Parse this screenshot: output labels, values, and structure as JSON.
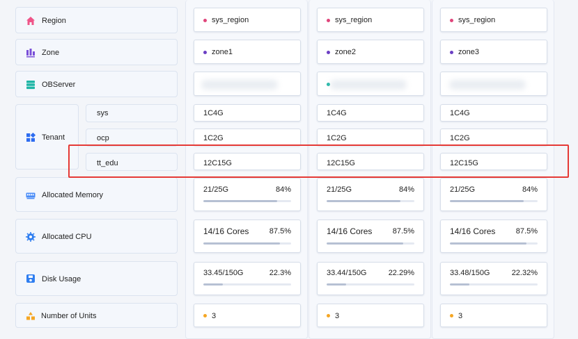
{
  "accent": "#4a6cf7",
  "rows": {
    "region": {
      "label": "Region",
      "icon": "home-icon",
      "icon_color": "#ef5589"
    },
    "zone": {
      "label": "Zone",
      "icon": "bar-chart-icon",
      "icon_color": "#7a4fd8"
    },
    "observer": {
      "label": "OBServer",
      "icon": "server-icon",
      "icon_color": "#1fb6a6"
    },
    "tenant": {
      "label": "Tenant",
      "icon": "grid-icon",
      "icon_color": "#2d6cf0"
    },
    "tenant_names": [
      "sys",
      "ocp",
      "tt_edu"
    ],
    "memory": {
      "label": "Allocated Memory",
      "icon": "memory-icon",
      "icon_color": "#4a8cf7"
    },
    "cpu": {
      "label": "Allocated CPU",
      "icon": "cpu-icon",
      "icon_color": "#2f7ef0"
    },
    "disk": {
      "label": "Disk Usage",
      "icon": "disk-icon",
      "icon_color": "#2f7ef0"
    },
    "units": {
      "label": "Number of Units",
      "icon": "units-icon",
      "icon_color": "#f5a623"
    }
  },
  "zones": [
    {
      "region": "sys_region",
      "region_dot": "#e0457b",
      "zone": "zone1",
      "zone_dot": "#6b3fc4",
      "tenants": [
        "1C4G",
        "1C2G",
        "12C15G"
      ],
      "memory": {
        "value": "21/25G",
        "pct": "84%",
        "fraction": 0.84
      },
      "cpu": {
        "value": "14/16 Cores",
        "pct": "87.5%",
        "fraction": 0.875
      },
      "disk": {
        "value": "33.45/150G",
        "pct": "22.3%",
        "fraction": 0.223
      },
      "units": "3",
      "units_dot": "#f5a623"
    },
    {
      "region": "sys_region",
      "region_dot": "#e0457b",
      "zone": "zone2",
      "zone_dot": "#6b3fc4",
      "tenants": [
        "1C4G",
        "1C2G",
        "12C15G"
      ],
      "memory": {
        "value": "21/25G",
        "pct": "84%",
        "fraction": 0.84
      },
      "cpu": {
        "value": "14/16 Cores",
        "pct": "87.5%",
        "fraction": 0.875
      },
      "disk": {
        "value": "33.44/150G",
        "pct": "22.29%",
        "fraction": 0.2229
      },
      "units": "3",
      "units_dot": "#f5a623"
    },
    {
      "region": "sys_region",
      "region_dot": "#e0457b",
      "zone": "zone3",
      "zone_dot": "#6b3fc4",
      "tenants": [
        "1C4G",
        "1C2G",
        "12C15G"
      ],
      "memory": {
        "value": "21/25G",
        "pct": "84%",
        "fraction": 0.84
      },
      "cpu": {
        "value": "14/16 Cores",
        "pct": "87.5%",
        "fraction": 0.875
      },
      "disk": {
        "value": "33.48/150G",
        "pct": "22.32%",
        "fraction": 0.2232
      },
      "units": "3",
      "units_dot": "#f5a623"
    }
  ]
}
